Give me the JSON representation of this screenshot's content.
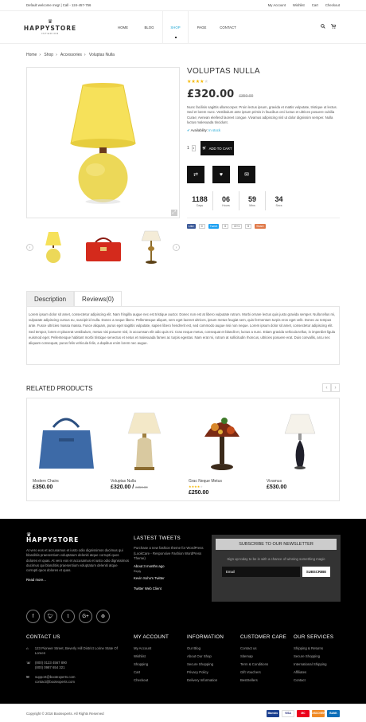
{
  "topbar": {
    "welcome": "Default welcome msg! | Call - 124-457-756",
    "links": [
      "My Account",
      "Wishlist",
      "Cart",
      "Checkout"
    ]
  },
  "logo": {
    "name": "HAPPYSTORE",
    "tagline": "INTERIOR"
  },
  "nav": [
    "HOME",
    "BLOG",
    "SHOP",
    "PAGE",
    "CONTACT"
  ],
  "breadcrumb": [
    "Home",
    "Shop",
    "Accessories",
    "Voluptas Nulla"
  ],
  "product": {
    "title": "VOLUPTAS NULLA",
    "rating": 4,
    "price": "£320.00",
    "old_price": "£350.00",
    "description": "Nunc facilisis sagittis ullamcorper. Proin lectus ipsum, gravida et mattis vulputate, tristique ut lectus. Sed et lorem nunc. Vestibulum ante ipsum primis in faucibus orci luctus et ultrices posuere cubilia Curae; Aenean eleifend laoreet congue. Vivamus adipiscing nisl ut dolor dignissim semper. Nulla luctus malesuada tincidunt.",
    "availability_label": "Availability:",
    "availability_value": "In stock",
    "qty": "1",
    "add_to_cart": "ADD TO CART",
    "countdown": [
      {
        "n": "1188",
        "u": "Days"
      },
      {
        "n": "06",
        "u": "Hours"
      },
      {
        "n": "59",
        "u": "Mins"
      },
      {
        "n": "34",
        "u": "Secs"
      }
    ],
    "share": {
      "like": "Like",
      "like_count": "0",
      "tweet": "Tweet",
      "tweet_count": "0",
      "gplus": "G+1",
      "gplus_count": "0",
      "share": "Share"
    }
  },
  "tabs": [
    "Description",
    "Reviews(0)"
  ],
  "tab_body": "Lorem ipsum dolor sit amet, consectetur adipiscing elit. Nam fringilla augue nec est tristique auctor. Donec non est at libero vulputate rutrum. Morbi ornare lectus quis justo gravida semper. Nulla tellus mi, vulputate adipiscing cursus eu, suscipit id nulla. Donec a neque libero. Pellentesque aliquet, sem eget laoreet ultrices, ipsum metus feugiat sem, quis fermentum turpis eros eget velit. Donec ac tempus ante. Fusce ultricies massa massa. Fusce aliquam, purus eget sagittis vulputate, sapien libero hendrerit est, sed commodo augue nisi non neque. Lorem ipsum dolor sit amet, consectetur adipiscing elit. Sed tempor, lorem et placerat vestibulum, metus nisi posuere nisl, in accumsan elit odio quis mi. Cras neque metus, consequat et blandit et, luctus a nunc. Etiam gravida vehicula tellus, in imperdiet ligula euismod eget. Pellentesque habitant morbi tristique senectus et netus et malesuada fames ac turpis egestas. Nam erat mi, rutrum at sollicitudin rhoncus, ultricies posuere erat. Duis convallis, arcu nec aliquam consequat, purus felis vehicula felis, a dapibus enim lorem nec augue.",
  "related": {
    "title": "RELATED PRODUCTS",
    "items": [
      {
        "name": "Modern Chairs",
        "price": "£350.00",
        "old": "",
        "rating": 0
      },
      {
        "name": "Voluptas Nulla",
        "price": "£320.00 /",
        "old": "£350.00",
        "rating": 0
      },
      {
        "name": "Grac Neque Metus",
        "price": "£250.00",
        "old": "",
        "rating": 4
      },
      {
        "name": "Vivamus",
        "price": "£530.00",
        "old": "",
        "rating": 0
      }
    ]
  },
  "footer": {
    "about": "At vero eos et accusamus et iusto odio dignissimos ducimus qui blanditiis praesentium voluptatum deleniti atque corrupti quos dolores et quas. At vero eos et accusamus et iusto odio dignissimos ducimus qui blanditiis praesentium voluptatum deleniti atque corrupti quos dolores et quas.",
    "read_more": "Read more...",
    "tweets_title": "LASTEST TWEETS",
    "tweet_text": "Purchase a new fashion theme for WordPress (LookCare - Responsive Fashion WordPress Theme)",
    "tweet_time": "About 3 months ago",
    "tweet_reply": "Reply",
    "tweet_author": "Kevin Soho's Twitter",
    "tweet_follow": "Twitter Web Client",
    "newsletter_title": "SUBSCRIBE TO OUR NEWSLETTER",
    "newsletter_text": "Sign up today to be in with a chance of winning something magic",
    "email_placeholder": "Email",
    "subscribe": "SUBSCRIBE",
    "contact_title": "CONTACT US",
    "contact_address": "123 Pioneer Street, Beverly Hill District Lorine State Of Loreen",
    "contact_phone1": "(800) 0123 4567 890",
    "contact_phone2": "(800) 0987 654 321",
    "contact_email1": "support@bootexperts.com",
    "contact_email2": "contact@bootexperts.com",
    "cols": [
      {
        "title": "MY ACCOUNT",
        "items": [
          "My Account",
          "Wishlist",
          "Shopping",
          "Cart",
          "Checkout"
        ]
      },
      {
        "title": "INFORMATION",
        "items": [
          "Our Blog",
          "About Our Shop",
          "Secure Shopping",
          "Privacy Policy",
          "Delivery Information"
        ]
      },
      {
        "title": "CUSTOMER CARE",
        "items": [
          "Contact us",
          "Sitemap",
          "Term & Conditions",
          "Gift Vouchers",
          "BestSellers"
        ]
      },
      {
        "title": "OUR SERVICES",
        "items": [
          "Shipping & Returns",
          "Secure Shopping",
          "International Shipping",
          "Affiliates",
          "Contact"
        ]
      }
    ],
    "copyright": "Copyright © 2016 Bootexperts. All Rights Reserved",
    "payments": [
      "Maestro",
      "VISA",
      "MC",
      "DISCOVER",
      "BANK"
    ]
  }
}
